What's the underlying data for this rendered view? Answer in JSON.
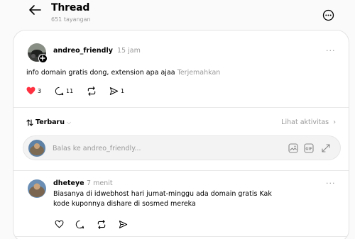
{
  "header": {
    "title": "Thread",
    "views": "651 tayangan"
  },
  "post": {
    "username": "andreo_friendly",
    "time": "15 jam",
    "text": "info domain gratis dong, extension apa ajaa",
    "translate": "Terjemahkan",
    "likes": "3",
    "comments": "11",
    "shares": "1",
    "like_color": "#ff3040"
  },
  "replies_header": {
    "sort_label": "Terbaru",
    "activity_label": "Lihat aktivitas"
  },
  "reply_box": {
    "placeholder": "Balas ke andreo_friendly..."
  },
  "reply": {
    "username": "dheteye",
    "time": "7 menit",
    "text_line1": "Biasanya di idwebhost hari jumat-minggu ada domain gratis Kak",
    "text_line2": "kode kuponnya dishare di sosmed mereka"
  },
  "icons": [
    "back-arrow-icon",
    "more-icon",
    "heart-icon",
    "comment-icon",
    "repost-icon",
    "share-icon",
    "gif-icon",
    "image-icon",
    "expand-icon"
  ]
}
